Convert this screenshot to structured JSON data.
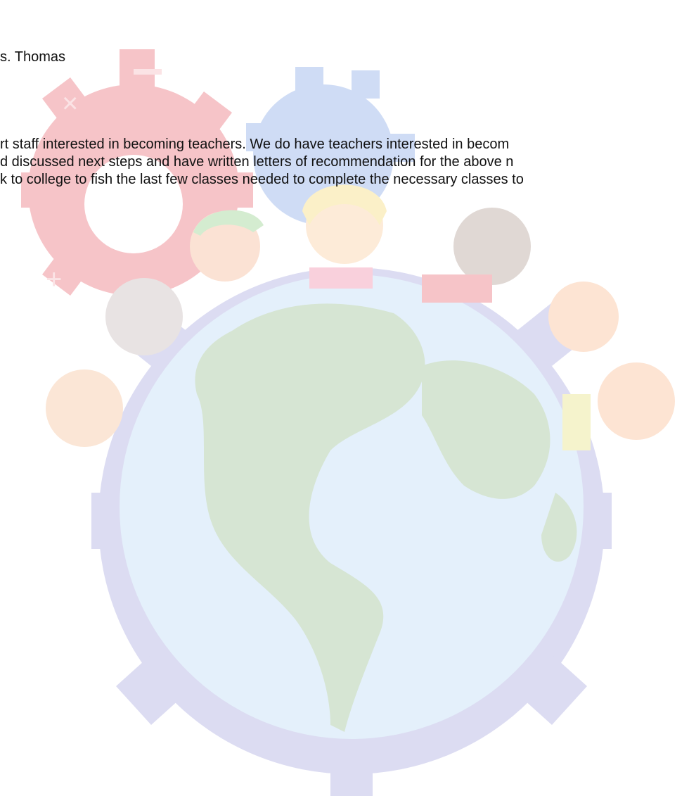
{
  "document": {
    "salutation_fragment": "s. Thomas",
    "body_lines": [
      "rt staff interested in becoming teachers. We do have teachers interested in becom",
      "d discussed next steps and have written letters of recommendation for the above n",
      "k to college to fish the last few classes needed to complete the necessary classes to"
    ]
  },
  "watermark": {
    "kind": "logo",
    "description_icon": "globe-children-gears-logo",
    "colors": {
      "red_gear": "#f3b8bd",
      "blue_gear": "#c9d8f4",
      "purple_gear": "#dcdcf2",
      "globe_ocean": "#e6f1fb",
      "globe_land": "#d9e6d6"
    }
  }
}
